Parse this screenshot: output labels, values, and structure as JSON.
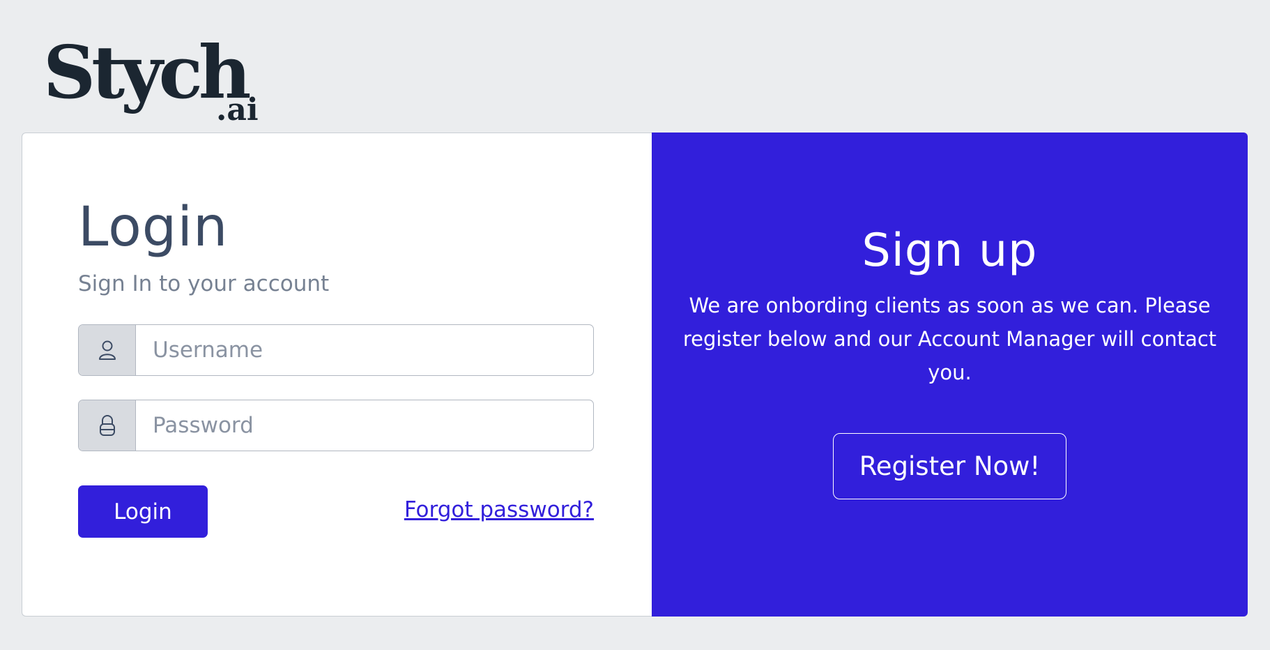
{
  "brand": {
    "logo_wordmark": "Stych",
    "logo_suffix": ".ai"
  },
  "login": {
    "title": "Login",
    "subtitle": "Sign In to your account",
    "username_placeholder": "Username",
    "username_icon": "user-icon",
    "password_placeholder": "Password",
    "password_icon": "lock-icon",
    "login_button_label": "Login",
    "forgot_password_label": "Forgot password?"
  },
  "signup": {
    "title": "Sign up",
    "text": "We are onbording clients as soon as we can. Please register below and our Account Manager will contact you.",
    "register_button_label": "Register Now!"
  },
  "colors": {
    "page_background": "#ebedef",
    "primary": "#321fdb",
    "heading_text": "#3c4b64",
    "muted_text": "#768192",
    "input_prepend": "#d8dbe0",
    "logo": "#1b2631"
  }
}
